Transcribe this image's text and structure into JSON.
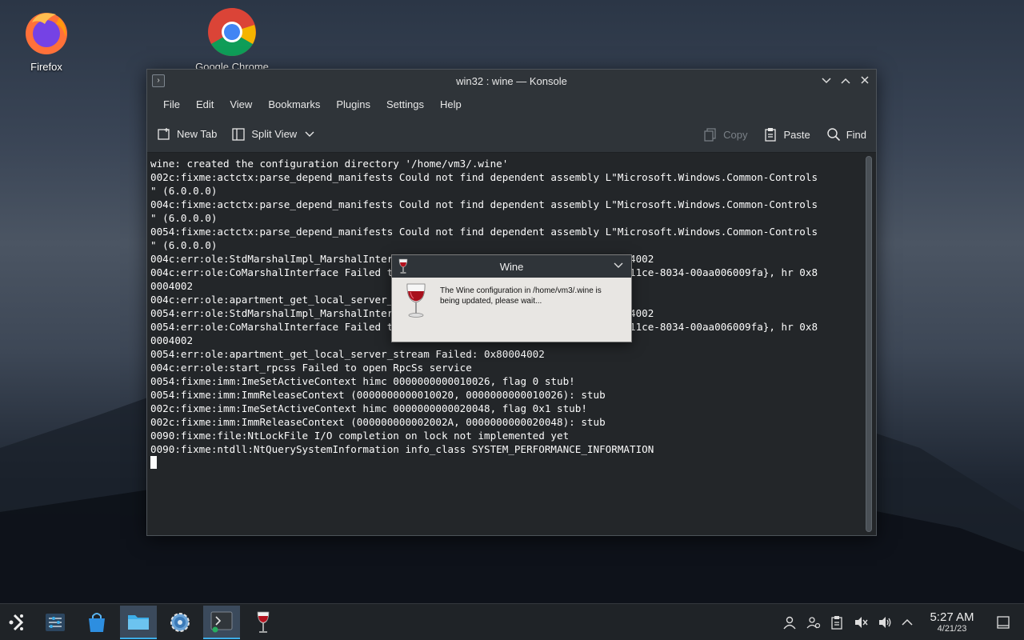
{
  "desktop": {
    "icons": [
      {
        "label": "Firefox",
        "icon": "firefox-icon"
      },
      {
        "label": "Google Chrome",
        "icon": "chrome-icon"
      }
    ]
  },
  "konsole": {
    "title": "win32 : wine — Konsole",
    "menu": [
      "File",
      "Edit",
      "View",
      "Bookmarks",
      "Plugins",
      "Settings",
      "Help"
    ],
    "toolbar": {
      "new_tab": "New Tab",
      "split_view": "Split View",
      "copy": "Copy",
      "paste": "Paste",
      "find": "Find"
    },
    "lines": [
      "wine: created the configuration directory '/home/vm3/.wine'",
      "002c:fixme:actctx:parse_depend_manifests Could not find dependent assembly L\"Microsoft.Windows.Common-Controls",
      "\" (6.0.0.0)",
      "004c:fixme:actctx:parse_depend_manifests Could not find dependent assembly L\"Microsoft.Windows.Common-Controls",
      "\" (6.0.0.0)",
      "0054:fixme:actctx:parse_depend_manifests Could not find dependent assembly L\"Microsoft.Windows.Common-Controls",
      "\" (6.0.0.0)",
      "004c:err:ole:StdMarshalImpl_MarshalInterface Failed to create ifstub, hr 0x80004002",
      "004c:err:ole:CoMarshalInterface Failed to marshal the interface {6d5140c1-7436-11ce-8034-00aa006009fa}, hr 0x8",
      "0004002",
      "004c:err:ole:apartment_get_local_server_stream Failed: 0x80004002",
      "0054:err:ole:StdMarshalImpl_MarshalInterface Failed to create ifstub, hr 0x80004002",
      "0054:err:ole:CoMarshalInterface Failed to marshal the interface {6d5140c1-7436-11ce-8034-00aa006009fa}, hr 0x8",
      "0004002",
      "0054:err:ole:apartment_get_local_server_stream Failed: 0x80004002",
      "004c:err:ole:start_rpcss Failed to open RpcSs service",
      "0054:fixme:imm:ImeSetActiveContext himc 0000000000010026, flag 0 stub!",
      "0054:fixme:imm:ImmReleaseContext (0000000000010020, 0000000000010026): stub",
      "002c:fixme:imm:ImeSetActiveContext himc 0000000000020048, flag 0x1 stub!",
      "002c:fixme:imm:ImmReleaseContext (000000000002002A, 0000000000020048): stub",
      "0090:fixme:file:NtLockFile I/O completion on lock not implemented yet",
      "0090:fixme:ntdll:NtQuerySystemInformation info_class SYSTEM_PERFORMANCE_INFORMATION"
    ]
  },
  "wine_dialog": {
    "title": "Wine",
    "message": "The Wine configuration in /home/vm3/.wine is being updated, please wait..."
  },
  "taskbar": {
    "time": "5:27 AM",
    "date": "4/21/23"
  }
}
